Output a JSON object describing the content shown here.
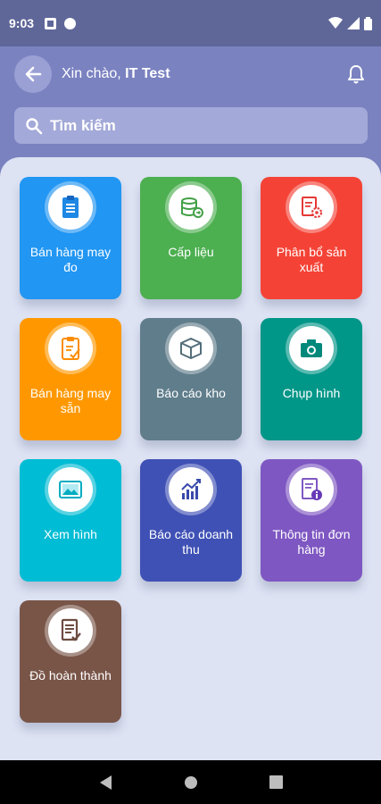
{
  "status": {
    "time": "9:03"
  },
  "header": {
    "greeting_prefix": "Xin chào, ",
    "user_name": "IT Test"
  },
  "search": {
    "placeholder": "Tìm kiếm"
  },
  "tiles": [
    {
      "label": "Bán hàng may đo",
      "color": "#2196f3",
      "icon": "clipboard-icon"
    },
    {
      "label": "Cấp liệu",
      "color": "#4caf50",
      "icon": "database-icon"
    },
    {
      "label": "Phân bổ sản xuất",
      "color": "#f44336",
      "icon": "gear-document-icon"
    },
    {
      "label": "Bán hàng may sẵn",
      "color": "#ff9800",
      "icon": "checklist-icon"
    },
    {
      "label": "Báo cáo kho",
      "color": "#607d8b",
      "icon": "box-icon"
    },
    {
      "label": "Chụp hình",
      "color": "#009688",
      "icon": "camera-icon"
    },
    {
      "label": "Xem hình",
      "color": "#00bcd4",
      "icon": "image-icon"
    },
    {
      "label": "Báo cáo doanh thu",
      "color": "#3f51b5",
      "icon": "chart-icon"
    },
    {
      "label": "Thông tin đơn hàng",
      "color": "#7e57c2",
      "icon": "document-info-icon"
    },
    {
      "label": "Đồ hoàn thành",
      "color": "#795548",
      "icon": "document-check-icon"
    }
  ]
}
